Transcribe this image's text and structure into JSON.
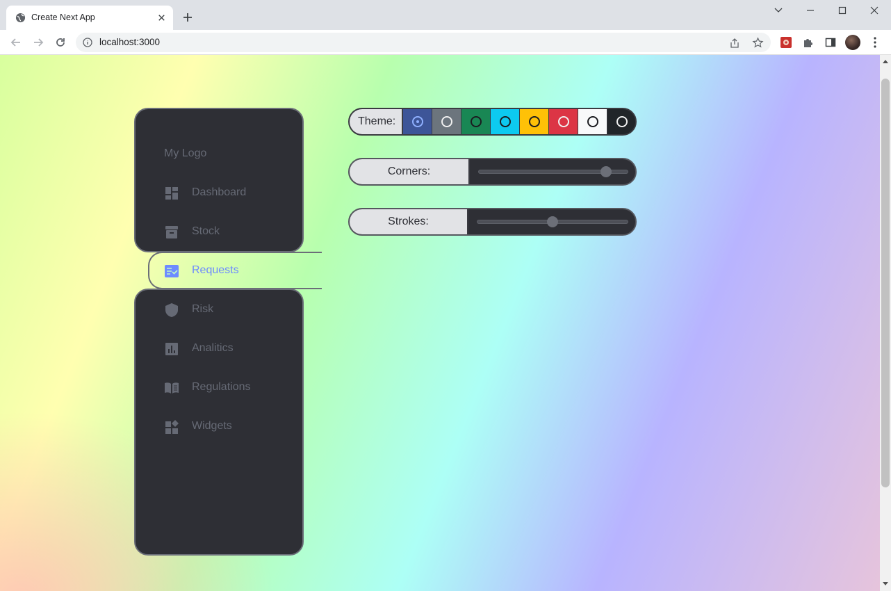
{
  "browser": {
    "tab_title": "Create Next App",
    "url": "localhost:3000"
  },
  "sidebar": {
    "logo": "My Logo",
    "items": [
      {
        "label": "Dashboard",
        "icon": "dashboard-icon",
        "active": false
      },
      {
        "label": "Stock",
        "icon": "archive-box-icon",
        "active": false
      },
      {
        "label": "Requests",
        "icon": "checklist-icon",
        "active": true
      },
      {
        "label": "Risk",
        "icon": "shield-icon",
        "active": false
      },
      {
        "label": "Analitics",
        "icon": "bar-chart-icon",
        "active": false
      },
      {
        "label": "Regulations",
        "icon": "open-book-icon",
        "active": false
      },
      {
        "label": "Widgets",
        "icon": "widgets-icon",
        "active": false
      }
    ]
  },
  "theme": {
    "label": "Theme:",
    "options": [
      {
        "color": "#3d5598",
        "selected": true
      },
      {
        "color": "#6c757d",
        "selected": false
      },
      {
        "color": "#198754",
        "selected": false
      },
      {
        "color": "#0dcaf0",
        "selected": false
      },
      {
        "color": "#ffc107",
        "selected": false
      },
      {
        "color": "#dc3545",
        "selected": false
      },
      {
        "color": "#f8f9fa",
        "selected": false
      },
      {
        "color": "#212529",
        "selected": false
      }
    ]
  },
  "corners": {
    "label": "Corners:",
    "value": 0.85
  },
  "strokes": {
    "label": "Strokes:",
    "value": 0.5
  },
  "colors": {
    "accent": "#6d8bff",
    "panel": "#2e2f35",
    "muted_text": "#666a75"
  }
}
